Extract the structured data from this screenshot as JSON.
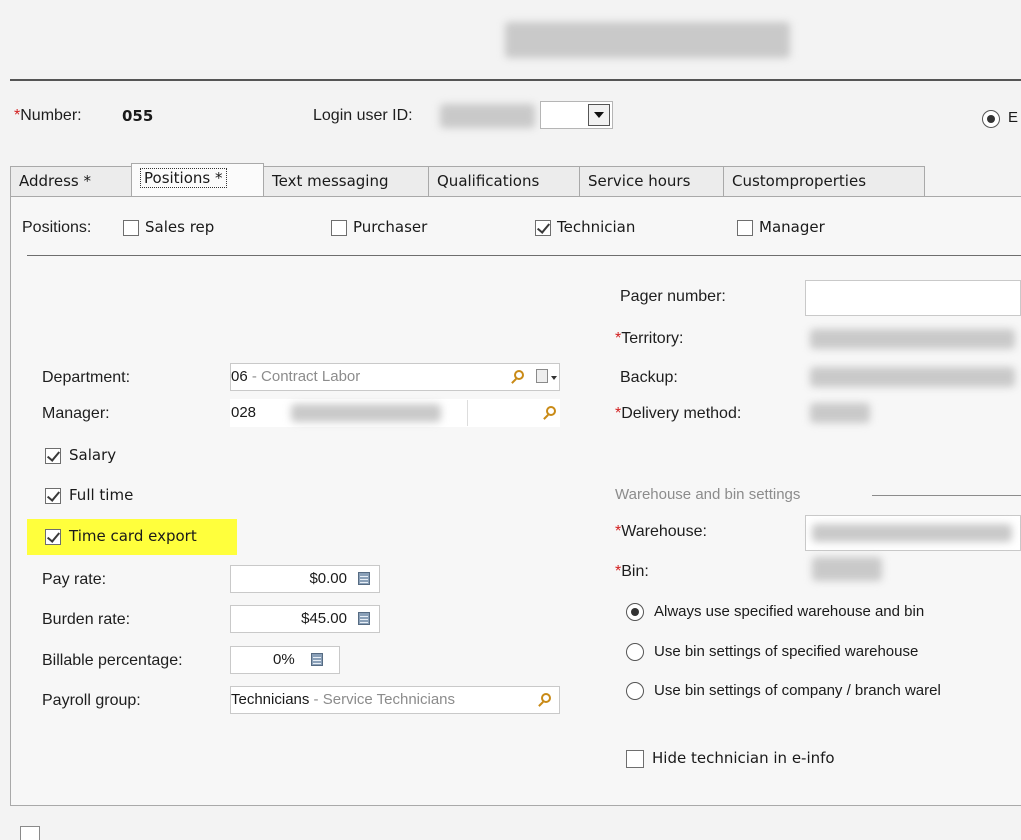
{
  "header": {
    "number_label": "Number:",
    "number_value": "055",
    "login_label": "Login user ID:",
    "radio_partial": "E"
  },
  "tabs": [
    {
      "label": "Address *"
    },
    {
      "label": "Positions *"
    },
    {
      "label": "Text messaging"
    },
    {
      "label": "Qualifications"
    },
    {
      "label": "Service hours"
    },
    {
      "label": "Customproperties"
    }
  ],
  "positions": {
    "label": "Positions:",
    "sales_rep": {
      "label": "Sales rep",
      "checked": false
    },
    "purchaser": {
      "label": "Purchaser",
      "checked": false
    },
    "technician": {
      "label": "Technician",
      "checked": true
    },
    "manager": {
      "label": "Manager",
      "checked": false
    }
  },
  "left": {
    "department_label": "Department:",
    "department_code": "06",
    "department_sep": " - ",
    "department_desc": "Contract Labor",
    "manager_label": "Manager:",
    "manager_code": "028",
    "salary": {
      "label": "Salary",
      "checked": true
    },
    "full_time": {
      "label": "Full time",
      "checked": true
    },
    "time_card_export": {
      "label": "Time card export",
      "checked": true
    },
    "pay_rate_label": "Pay rate:",
    "pay_rate_value": "$0.00",
    "burden_rate_label": "Burden rate:",
    "burden_rate_value": "$45.00",
    "billable_label": "Billable percentage:",
    "billable_value": "0%",
    "payroll_label": "Payroll group:",
    "payroll_code": "Technicians",
    "payroll_sep": " - ",
    "payroll_desc": "Service Technicians"
  },
  "right": {
    "pager_label": "Pager number:",
    "territory_label": "Territory:",
    "backup_label": "Backup:",
    "delivery_label": "Delivery method:",
    "warehouse_group": "Warehouse and bin settings",
    "warehouse_label": "Warehouse:",
    "bin_label": "Bin:",
    "radio_options": [
      {
        "label": "Always use specified warehouse and bin",
        "selected": true
      },
      {
        "label": "Use bin settings of specified warehouse",
        "selected": false
      },
      {
        "label": "Use bin settings of company / branch warel",
        "selected": false
      }
    ],
    "hide_technician": {
      "label": "Hide technician in e-info",
      "checked": false
    }
  },
  "colors": {
    "highlight": "#ffff3c",
    "required": "#d21f1f",
    "muted_text": "#8c8c8c"
  }
}
